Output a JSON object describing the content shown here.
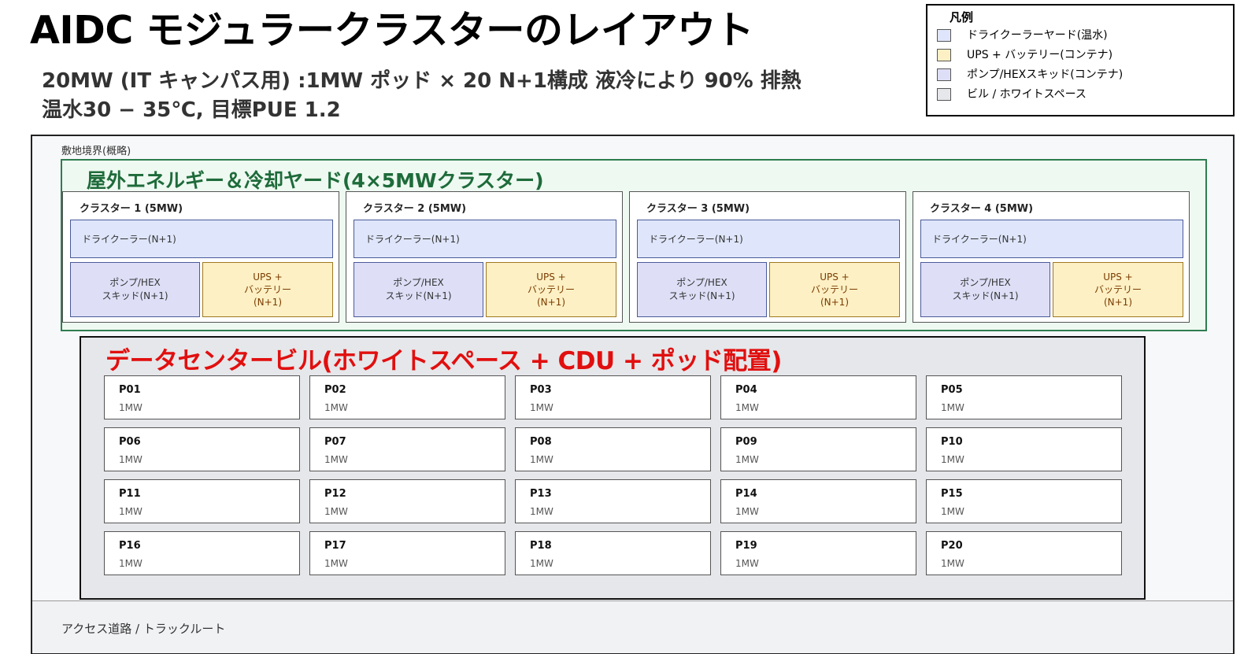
{
  "title": "AIDC モジュラークラスターのレイアウト",
  "subtitle_line1": "20MW (IT キャンパス用) :1MW ポッド × 20  N+1構成   液冷により 90% 排熱",
  "subtitle_line2": "温水30 − 35℃, 目標PUE 1.2",
  "legend": {
    "title": "凡例",
    "items": [
      {
        "label": "ドライクーラーヤード(温水)",
        "color": "#dfe6fb"
      },
      {
        "label": "UPS + バッテリー(コンテナ)",
        "color": "#fdf0c4"
      },
      {
        "label": "ポンプ/HEXスキッド(コンテナ)",
        "color": "#dedff7"
      },
      {
        "label": "ビル / ホワイトスペース",
        "color": "#e6e7ea"
      }
    ]
  },
  "site": {
    "boundary_label": "敷地境界(概略)",
    "road_label": "アクセス道路 / トラックルート"
  },
  "yard": {
    "title": "屋外エネルギー＆冷却ヤード(4×5MWクラスター)",
    "clusters": [
      {
        "title": "クラスター 1 (5MW)",
        "cooler": "ドライクーラー(N+1)",
        "pump": "ポンプ/HEX\nスキッド(N+1)",
        "ups": "UPS +\nバッテリー\n(N+1)"
      },
      {
        "title": "クラスター 2 (5MW)",
        "cooler": "ドライクーラー(N+1)",
        "pump": "ポンプ/HEX\nスキッド(N+1)",
        "ups": "UPS +\nバッテリー\n(N+1)"
      },
      {
        "title": "クラスター 3 (5MW)",
        "cooler": "ドライクーラー(N+1)",
        "pump": "ポンプ/HEX\nスキッド(N+1)",
        "ups": "UPS +\nバッテリー\n(N+1)"
      },
      {
        "title": "クラスター 4 (5MW)",
        "cooler": "ドライクーラー(N+1)",
        "pump": "ポンプ/HEX\nスキッド(N+1)",
        "ups": "UPS +\nバッテリー\n(N+1)"
      }
    ]
  },
  "datacenter": {
    "title": "データセンタービル(ホワイトスペース + CDU + ポッド配置)",
    "pods": [
      {
        "name": "P01",
        "capacity": "1MW"
      },
      {
        "name": "P02",
        "capacity": "1MW"
      },
      {
        "name": "P03",
        "capacity": "1MW"
      },
      {
        "name": "P04",
        "capacity": "1MW"
      },
      {
        "name": "P05",
        "capacity": "1MW"
      },
      {
        "name": "P06",
        "capacity": "1MW"
      },
      {
        "name": "P07",
        "capacity": "1MW"
      },
      {
        "name": "P08",
        "capacity": "1MW"
      },
      {
        "name": "P09",
        "capacity": "1MW"
      },
      {
        "name": "P10",
        "capacity": "1MW"
      },
      {
        "name": "P11",
        "capacity": "1MW"
      },
      {
        "name": "P12",
        "capacity": "1MW"
      },
      {
        "name": "P13",
        "capacity": "1MW"
      },
      {
        "name": "P14",
        "capacity": "1MW"
      },
      {
        "name": "P15",
        "capacity": "1MW"
      },
      {
        "name": "P16",
        "capacity": "1MW"
      },
      {
        "name": "P17",
        "capacity": "1MW"
      },
      {
        "name": "P18",
        "capacity": "1MW"
      },
      {
        "name": "P19",
        "capacity": "1MW"
      },
      {
        "name": "P20",
        "capacity": "1MW"
      }
    ]
  }
}
